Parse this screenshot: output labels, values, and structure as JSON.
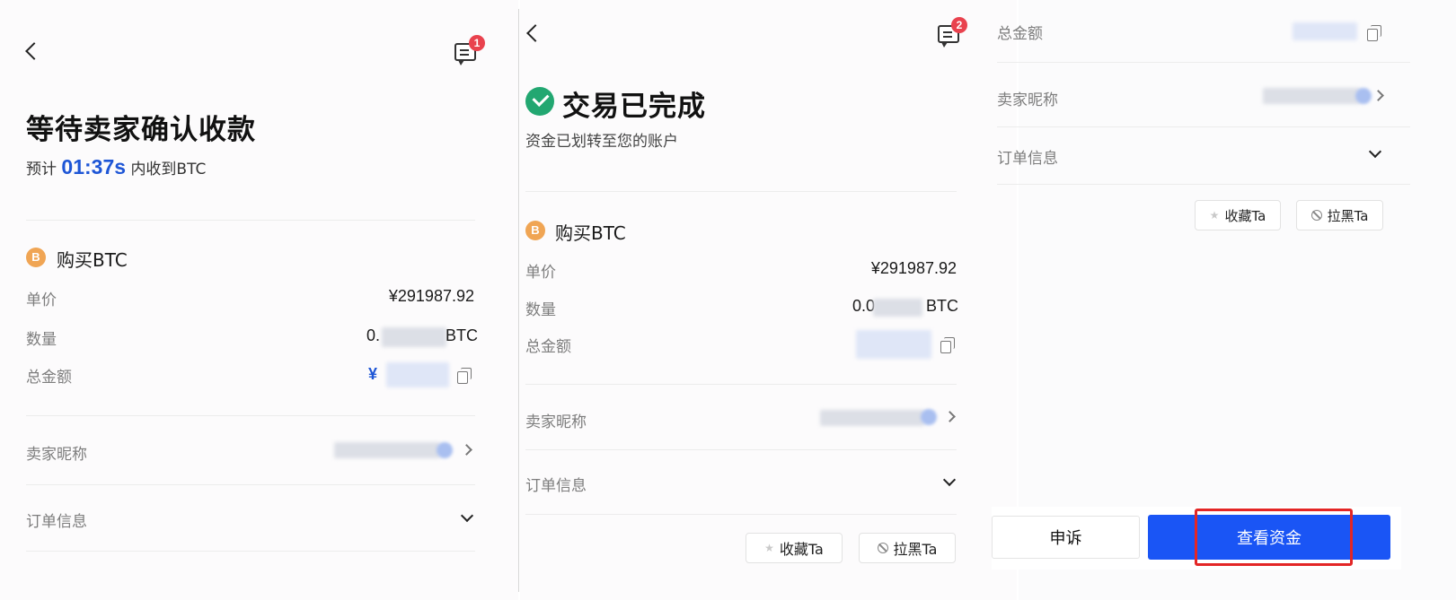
{
  "panel1": {
    "title": "等待卖家确认收款",
    "eta_prefix": "预计",
    "eta_timer": "01:37s",
    "eta_suffix": "内收到BTC",
    "message_badge": "1",
    "coin_letter": "B",
    "section_title": "购买BTC",
    "rows": {
      "price_label": "单价",
      "price_value": "¥291987.92",
      "qty_label": "数量",
      "qty_prefix": "0.",
      "qty_unit": "BTC",
      "total_label": "总金额",
      "total_prefix": "¥"
    },
    "seller_label": "卖家昵称",
    "order_info_label": "订单信息"
  },
  "panel2": {
    "message_badge": "2",
    "status_title": "交易已完成",
    "status_subtitle": "资金已划转至您的账户",
    "coin_letter": "B",
    "section_title": "购买BTC",
    "rows": {
      "price_label": "单价",
      "price_value": "¥291987.92",
      "qty_label": "数量",
      "qty_prefix": "0.0",
      "qty_unit": "BTC",
      "total_label": "总金额"
    },
    "seller_label": "卖家昵称",
    "order_info_label": "订单信息",
    "favorite_label": "收藏Ta",
    "block_label": "拉黑Ta"
  },
  "panel3": {
    "total_label": "总金额",
    "seller_label": "卖家昵称",
    "order_info_label": "订单信息",
    "favorite_label": "收藏Ta",
    "block_label": "拉黑Ta",
    "appeal_label": "申诉",
    "view_funds_label": "查看资金"
  },
  "colors": {
    "accent_blue": "#1a55f5",
    "timer_blue": "#1e56d6",
    "success_green": "#22a771",
    "coin_orange": "#f0a554",
    "badge_red": "#e9424e",
    "highlight_red": "#e32626"
  },
  "icons": [
    "back-arrow-icon",
    "message-icon",
    "bitcoin-icon",
    "copy-icon",
    "chevron-right-icon",
    "chevron-down-icon",
    "check-circle-icon",
    "star-icon",
    "ban-icon"
  ]
}
